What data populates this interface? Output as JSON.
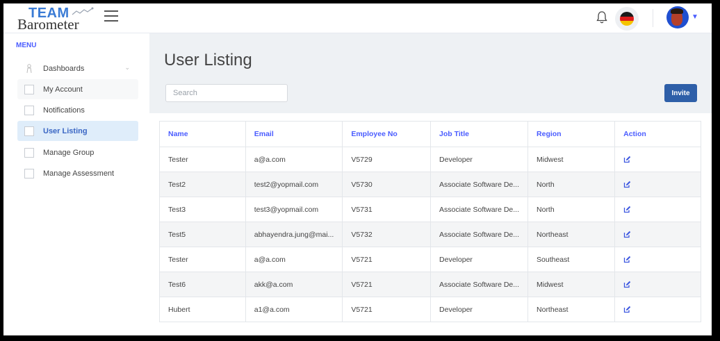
{
  "brand": {
    "line1": "TEAM",
    "line2": "Barometer"
  },
  "sidebar": {
    "menu_title": "MENU",
    "items": [
      {
        "label": "Dashboards"
      },
      {
        "label": "My Account"
      },
      {
        "label": "Notifications"
      },
      {
        "label": "User Listing"
      },
      {
        "label": "Manage Group"
      },
      {
        "label": "Manage Assessment"
      }
    ]
  },
  "main": {
    "title": "User Listing",
    "search_placeholder": "Search",
    "invite_label": "Invite"
  },
  "table": {
    "headers": [
      "Name",
      "Email",
      "Employee No",
      "Job Title",
      "Region",
      "Action"
    ],
    "rows": [
      [
        "Tester",
        "a@a.com",
        "V5729",
        "Developer",
        "Midwest"
      ],
      [
        "Test2",
        "test2@yopmail.com",
        "V5730",
        "Associate Software De...",
        "North"
      ],
      [
        "Test3",
        "test3@yopmail.com",
        "V5731",
        "Associate Software De...",
        "North"
      ],
      [
        "Test5",
        "abhayendra.jung@mai...",
        "V5732",
        "Associate Software De...",
        "Northeast"
      ],
      [
        "Tester",
        "a@a.com",
        "V5721",
        "Developer",
        "Southeast"
      ],
      [
        "Test6",
        "akk@a.com",
        "V5721",
        "Associate Software De...",
        "Midwest"
      ],
      [
        "Hubert",
        "a1@a.com",
        "V5721",
        "Developer",
        "Northeast"
      ]
    ]
  },
  "colors": {
    "accent": "#4a5cff",
    "invite_button": "#2e5fa8",
    "active_item_bg": "#dfedfa",
    "band_bg": "#eef1f4"
  },
  "icons": [
    "sparkline-logo-icon",
    "hamburger-menu-icon",
    "bell-icon",
    "germany-flag-icon",
    "avatar",
    "chevron-down-icon",
    "box-icon",
    "edit-icon"
  ]
}
